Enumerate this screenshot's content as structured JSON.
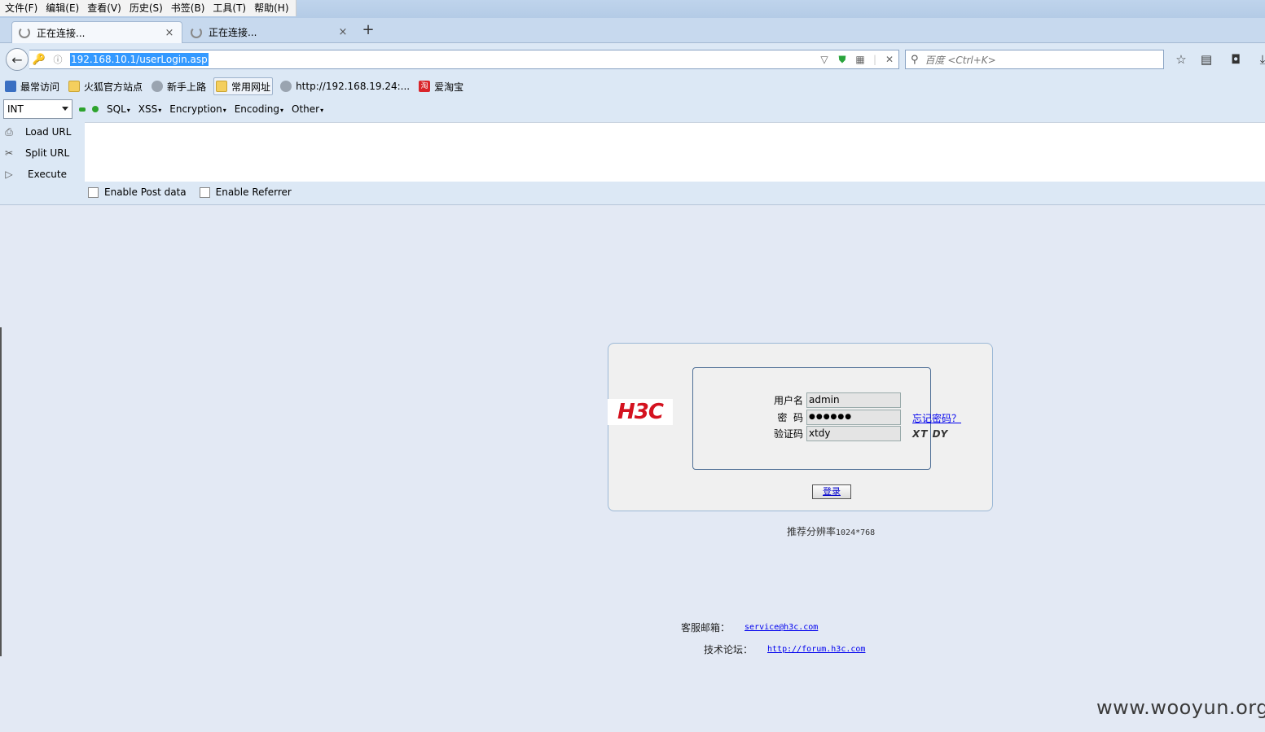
{
  "menu": [
    "文件(F)",
    "编辑(E)",
    "查看(V)",
    "历史(S)",
    "书签(B)",
    "工具(T)",
    "帮助(H)"
  ],
  "tabs": [
    {
      "label": "正在连接...",
      "close": "×"
    },
    {
      "label": "正在连接...",
      "close": "×"
    }
  ],
  "newtab": "+",
  "address": {
    "url": "192.168.10.1/userLogin.asp",
    "clear": "✕"
  },
  "search": {
    "placeholder": "百度 <Ctrl+K>"
  },
  "bookmarks": [
    "最常访问",
    "火狐官方站点",
    "新手上路",
    "常用网址",
    "http://192.168.19.24:...",
    "爱淘宝"
  ],
  "hackbar": {
    "select": "INT",
    "menus": [
      "SQL",
      "XSS",
      "Encryption",
      "Encoding",
      "Other"
    ],
    "buttons": [
      "Load URL",
      "Split URL",
      "Execute"
    ],
    "checks": [
      "Enable Post data",
      "Enable Referrer"
    ]
  },
  "login": {
    "logo": "H3C",
    "username_label": "用户名",
    "username_value": "admin",
    "password_label": "密  码",
    "password_value": "●●●●●●",
    "captcha_label": "验证码",
    "captcha_value": "xtdy",
    "captcha_image_text": "XT DY",
    "forgot": "忘记密码？",
    "submit": "登录",
    "resolution_text": "推荐分辨率",
    "resolution_num": "1024*768"
  },
  "contact": {
    "email_label": "客服邮箱：",
    "email": "service@h3c.com",
    "forum_label": "技术论坛：",
    "forum": "http://forum.h3c.com"
  },
  "watermark": "www.wooyun.org",
  "colors": {
    "accent": "#3399ff",
    "logo": "#d4121f",
    "link": "#0000ee"
  }
}
